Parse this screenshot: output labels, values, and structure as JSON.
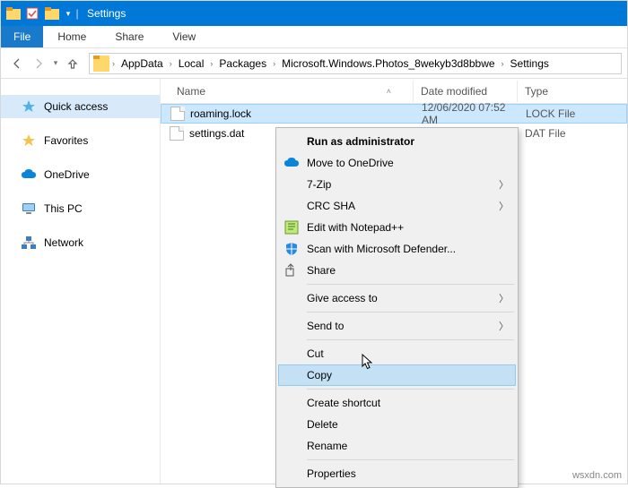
{
  "window": {
    "title": "Settings"
  },
  "ribbon": {
    "file": "File",
    "tabs": [
      "Home",
      "Share",
      "View"
    ]
  },
  "breadcrumbs": [
    "AppData",
    "Local",
    "Packages",
    "Microsoft.Windows.Photos_8wekyb3d8bbwe",
    "Settings"
  ],
  "nav": {
    "quick_access": "Quick access",
    "favorites": "Favorites",
    "onedrive": "OneDrive",
    "thispc": "This PC",
    "network": "Network"
  },
  "columns": {
    "name": "Name",
    "date": "Date modified",
    "type": "Type"
  },
  "files": [
    {
      "name": "roaming.lock",
      "date": "12/06/2020 07:52 AM",
      "type": "LOCK File"
    },
    {
      "name": "settings.dat",
      "date": "",
      "type": "DAT File"
    }
  ],
  "ctx": {
    "run_admin": "Run as administrator",
    "onedrive": "Move to OneDrive",
    "sevenzip": "7-Zip",
    "crcsha": "CRC SHA",
    "notepadpp": "Edit with Notepad++",
    "defender": "Scan with Microsoft Defender...",
    "share": "Share",
    "give_access": "Give access to",
    "send_to": "Send to",
    "cut": "Cut",
    "copy": "Copy",
    "shortcut": "Create shortcut",
    "delete": "Delete",
    "rename": "Rename",
    "properties": "Properties"
  },
  "watermark": "wsxdn.com"
}
